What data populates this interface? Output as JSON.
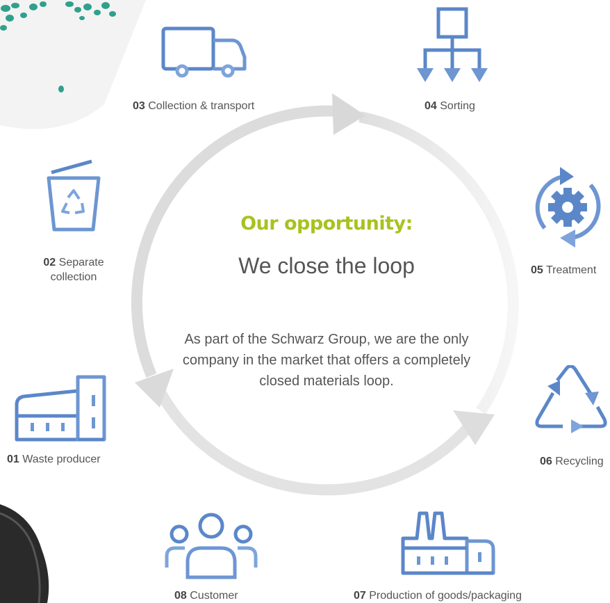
{
  "center": {
    "title": "Our opportunity:",
    "subtitle": "We close the loop",
    "description": "As part of the Schwarz Group, we are the only company in the market that offers a completely closed materials loop."
  },
  "steps": [
    {
      "num": "01",
      "label": "Waste producer",
      "icon": "factory-icon"
    },
    {
      "num": "02",
      "label": "Separate",
      "label2": "collection",
      "icon": "recycling-bin-icon"
    },
    {
      "num": "03",
      "label": "Collection & transport",
      "icon": "truck-icon"
    },
    {
      "num": "04",
      "label": "Sorting",
      "icon": "sorting-hierarchy-icon"
    },
    {
      "num": "05",
      "label": "Treatment",
      "icon": "gear-cycle-icon"
    },
    {
      "num": "06",
      "label": "Recycling",
      "icon": "recycle-icon"
    },
    {
      "num": "07",
      "label": "Production of goods/packaging",
      "icon": "production-plant-icon"
    },
    {
      "num": "08",
      "label": "Customer",
      "icon": "people-group-icon"
    }
  ],
  "colors": {
    "accent": "#a7c31f",
    "icon_blue": "#5b87c9",
    "loop_grey": "#dcdcdc",
    "granule_teal": "#2fa08c"
  }
}
